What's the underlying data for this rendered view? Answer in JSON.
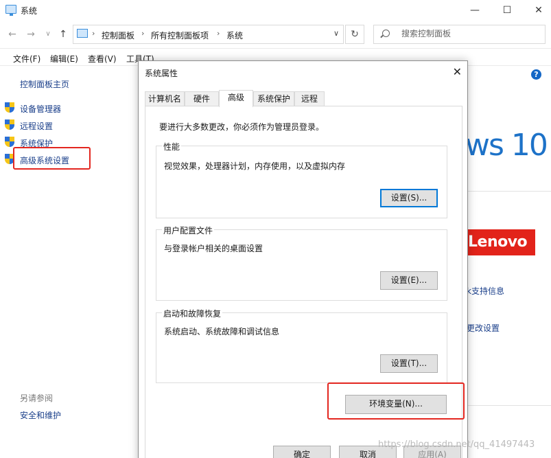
{
  "window": {
    "title": "系统",
    "controls": {
      "minimize": "—",
      "maximize": "☐",
      "close": "✕"
    }
  },
  "address_bar": {
    "breadcrumbs": [
      "控制面板",
      "所有控制面板项",
      "系统"
    ],
    "separator": "›",
    "search_placeholder": "搜索控制面板"
  },
  "menu": [
    "文件(F)",
    "编辑(E)",
    "查看(V)",
    "工具(T)"
  ],
  "left_pane": {
    "home": "控制面板主页",
    "links": [
      "设备管理器",
      "远程设置",
      "系统保护",
      "高级系统设置"
    ],
    "see_also": "另请参阅",
    "security": "安全和维护"
  },
  "right_pane": {
    "windows_logo_text": "ws 10",
    "brand": "Lenovo",
    "support_link": "k支持信息",
    "change_settings_link": "更改设置",
    "help": "?"
  },
  "dialog": {
    "title": "系统属性",
    "close": "✕",
    "tabs": [
      "计算机名",
      "硬件",
      "高级",
      "系统保护",
      "远程"
    ],
    "active_tab": "高级",
    "admin_note": "要进行大多数更改，你必须作为管理员登录。",
    "performance": {
      "legend": "性能",
      "desc": "视觉效果，处理器计划，内存使用，以及虚拟内存",
      "button": "设置(S)..."
    },
    "user_profiles": {
      "legend": "用户配置文件",
      "desc": "与登录帐户相关的桌面设置",
      "button": "设置(E)..."
    },
    "startup_recovery": {
      "legend": "启动和故障恢复",
      "desc": "系统启动、系统故障和调试信息",
      "button": "设置(T)..."
    },
    "env_button": "环境变量(N)...",
    "ok": "确定",
    "cancel": "取消",
    "apply": "应用(A)"
  },
  "watermark": "https://blog.csdn.net/qq_41497443",
  "colors": {
    "highlight": "#e3261f",
    "link": "#1a3f8a",
    "accent": "#0078d7"
  }
}
